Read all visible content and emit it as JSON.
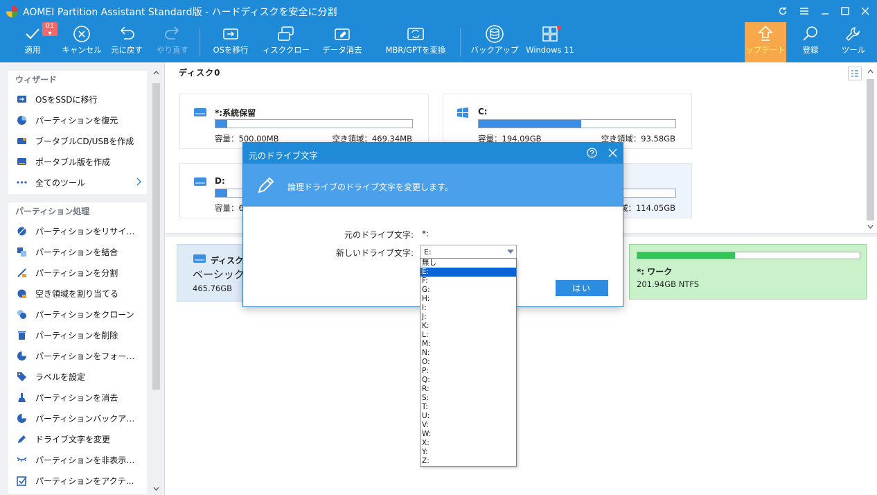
{
  "window": {
    "title": "AOMEI Partition Assistant Standard版 - ハードディスクを安全に分割"
  },
  "toolbar": {
    "apply": "適用",
    "pending_count": "01",
    "cancel": "キャンセル",
    "undo": "元に戻す",
    "redo": "やり直す",
    "migrate_os": "OSを移行",
    "disk_clone": "ィスククロー",
    "data_erase": "データ消去",
    "mbr_gpt": "MBR/GPTを変換",
    "backup": "バックアップ",
    "windows11": "Windows 11",
    "upgrade": "ップデート",
    "register": "登録",
    "tools": "ツール"
  },
  "sidebar": {
    "wizard_title": "ウィザード",
    "wizard_items": [
      {
        "label": "OSをSSDに移行",
        "icon": "drive-migrate-icon"
      },
      {
        "label": "パーティションを復元",
        "icon": "pie-restore-icon"
      },
      {
        "label": "ブータブルCD/USBを作成",
        "icon": "bootable-media-icon"
      },
      {
        "label": "ポータブル版を作成",
        "icon": "portable-icon"
      },
      {
        "label": "全てのツール",
        "icon": "more-dots-icon"
      }
    ],
    "partition_title": "パーティション処理",
    "partition_items": [
      {
        "label": "パーティションをリサイ…",
        "icon": "resize-icon"
      },
      {
        "label": "パーティションを結合",
        "icon": "merge-icon"
      },
      {
        "label": "パーティションを分割",
        "icon": "split-icon"
      },
      {
        "label": "空き領域を割り当てる",
        "icon": "allocate-icon"
      },
      {
        "label": "パーティションをクローン",
        "icon": "clone-icon"
      },
      {
        "label": "パーティションを削除",
        "icon": "trash-icon"
      },
      {
        "label": "パーティションをフォー…",
        "icon": "format-icon"
      },
      {
        "label": "ラベルを設定",
        "icon": "tag-icon"
      },
      {
        "label": "パーティションを消去",
        "icon": "wipe-icon"
      },
      {
        "label": "パーティションバックア…",
        "icon": "backup-pie-icon"
      },
      {
        "label": "ドライブ文字を変更",
        "icon": "pencil-icon"
      },
      {
        "label": "パーティションを非表示…",
        "icon": "eye-hidden-icon"
      },
      {
        "label": "パーティションをアクテ…",
        "icon": "checkbox-icon"
      }
    ]
  },
  "main": {
    "disk_title": "ディスク0",
    "cards": [
      {
        "name": "*:系統保留",
        "capacity": "容量：500.00MB",
        "free": "空き領域：469.34MB",
        "fill": 0.06
      },
      {
        "name": "C:",
        "capacity": "容量：194.09GB",
        "free": "空き領域：93.58GB",
        "fill": 0.52
      },
      {
        "name": "D:",
        "capacity": "容量：6",
        "free": "",
        "fill": 0.06
      },
      {
        "name": "",
        "capacity": "",
        "free": "域：114.05GB",
        "fill": 0
      }
    ],
    "summary": {
      "name": "ディスク",
      "type": "ベーシック",
      "size": "465.76GB"
    },
    "work_partition": {
      "name": "*: ワーク",
      "size": "201.94GB NTFS",
      "fill": 0.44
    }
  },
  "dialog": {
    "title": "元のドライブ文字",
    "banner": "論理ドライブのドライブ文字を変更します。",
    "current_label": "元のドライブ文字:",
    "current_value": "*:",
    "new_label": "新しいドライブ文字:",
    "new_value": "E:",
    "ok": "はい",
    "options": [
      "無し",
      "E:",
      "F:",
      "G:",
      "H:",
      "I:",
      "J:",
      "K:",
      "L:",
      "M:",
      "N:",
      "O:",
      "P:",
      "Q:",
      "R:",
      "S:",
      "T:",
      "U:",
      "V:",
      "W:",
      "X:",
      "Y:",
      "Z:"
    ],
    "selected_index": 1
  },
  "colors": {
    "accent": "#1f8ad8",
    "banner": "#4aa0ea",
    "upgrade": "#f8a84a",
    "bar_fill": "#3b8ee8",
    "work_bg": "#c9f2cb"
  }
}
